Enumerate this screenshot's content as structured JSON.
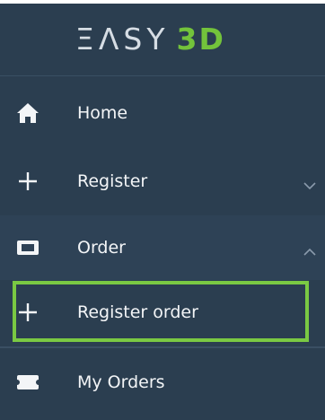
{
  "logo": {
    "part1": "ΞΛSY",
    "part2": "3D"
  },
  "menu": {
    "home": {
      "label": "Home",
      "icon": "home-icon"
    },
    "register": {
      "label": "Register",
      "icon": "plus-icon",
      "chevron": "chevron-down-icon"
    },
    "order": {
      "label": "Order",
      "icon": "ticket-icon",
      "chevron": "chevron-up-icon"
    },
    "register_order": {
      "label": "Register order",
      "icon": "plus-icon"
    },
    "my_orders": {
      "label": "My Orders",
      "icon": "ticket-icon"
    }
  },
  "colors": {
    "sidebar_bg": "#2b3e50",
    "accent_green": "#7ac943",
    "text": "#f3f5f7"
  }
}
